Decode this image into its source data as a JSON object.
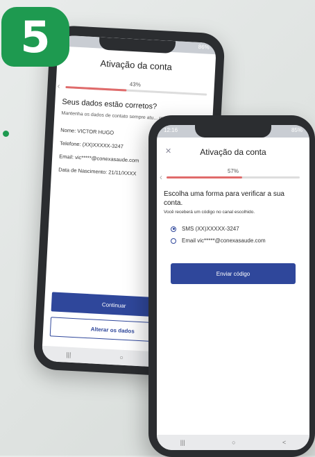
{
  "step_badge": "5",
  "phone_back": {
    "status_time": "",
    "status_battery": "86%",
    "title": "Ativação da conta",
    "progress_label": "43%",
    "progress_value": 0.43,
    "heading": "Seus dados estão corretos?",
    "description": "Mantenha os dados de contato sempre atu... receber informações sobre suas consulta...",
    "fields": {
      "name": "Nome: VICTOR HUGO",
      "phone": "Telefone: (XX)XXXXX-3247",
      "email": "Email: vic*****@conexasaude.com",
      "birthdate": "Data de Nascimento: 21/11/XXXX"
    },
    "continue_label": "Continuar",
    "edit_label": "Alterar os dados",
    "nav": [
      "|||",
      "○",
      "<"
    ]
  },
  "phone_front": {
    "status_time": "12:16",
    "status_battery": "85%",
    "title": "Ativação da conta",
    "progress_label": "57%",
    "progress_value": 0.57,
    "heading": "Escolha uma forma para verificar a sua conta.",
    "subheading": "Você receberá um código no canal escolhido.",
    "options": [
      {
        "label": "SMS (XX)XXXXX-3247",
        "selected": true
      },
      {
        "label": "Email vic*****@conexasaude.com",
        "selected": false
      }
    ],
    "send_label": "Enviar código",
    "nav": [
      "|||",
      "○",
      "<"
    ]
  },
  "colors": {
    "brand_green": "#1e9a50",
    "primary_blue": "#2f479b",
    "progress_red": "#e06b6b"
  },
  "icons": {
    "close": "close-icon",
    "back": "chevron-left-icon"
  }
}
